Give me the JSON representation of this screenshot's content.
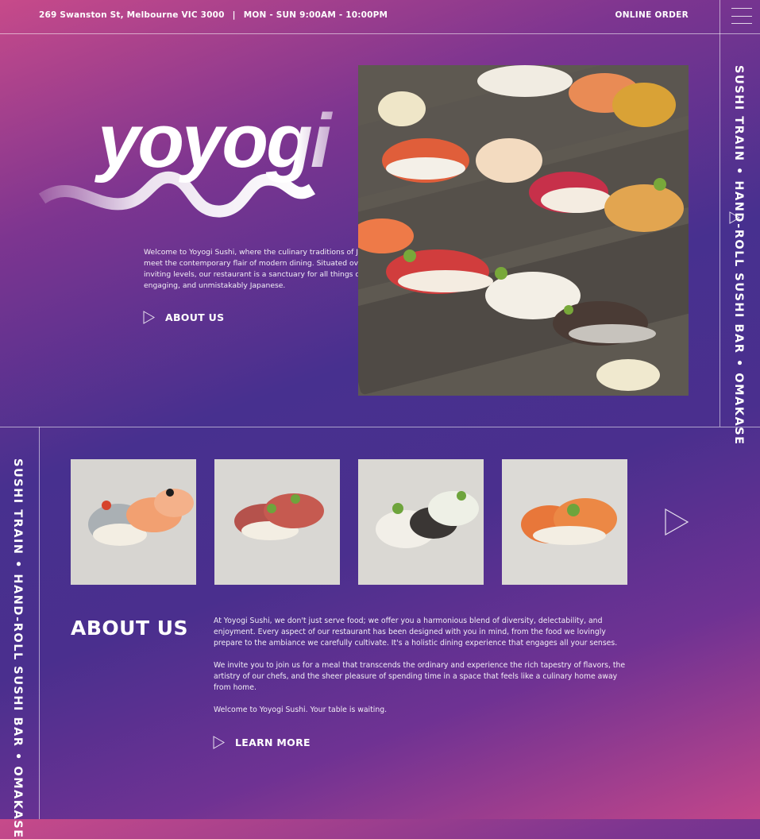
{
  "topbar": {
    "address": "269 Swanston St, Melbourne VIC 3000",
    "separator": "|",
    "hours": "MON - SUN  9:00AM - 10:00PM",
    "online_order": "ONLINE ORDER"
  },
  "rail": {
    "right_text": "SUSHI TRAIN  •  HAND-ROLL SUSHI BAR  •  OMAKASE",
    "left_text": "SUSHI TRAIN  •  HAND-ROLL SUSHI BAR  •  OMAKASE"
  },
  "hero": {
    "logo_text": "yoyogi",
    "welcome": "Welcome to Yoyogi Sushi, where the culinary traditions of Japan meet the contemporary flair of modern dining. Situated over two inviting levels, our restaurant is a sanctuary for all things delicious, engaging, and unmistakably Japanese.",
    "about_link": "ABOUT US"
  },
  "about": {
    "heading": "ABOUT US",
    "paragraph_1": "At Yoyogi Sushi, we don't just serve food; we offer you a harmonious blend of diversity, delectability, and enjoyment. Every aspect of our restaurant has been designed with you in mind, from the food we lovingly prepare to the ambiance we carefully cultivate. It's a holistic dining experience that engages all your senses.",
    "paragraph_2": "We invite you to join us for a meal that transcends the ordinary and experience the rich tapestry of flavors, the artistry of our chefs, and the sheer pleasure of spending time in a space that feels like a culinary home away from home.",
    "paragraph_3": "Welcome to Yoyogi Sushi. Your table is waiting.",
    "learn_more": "LEARN MORE"
  },
  "icons": {
    "menu": "hamburger-icon",
    "play": "play-outline-icon",
    "next": "next-arrow-icon"
  },
  "colors": {
    "gradient_pink": "#c74a8a",
    "gradient_purple": "#47308f",
    "text": "#ffffff"
  }
}
